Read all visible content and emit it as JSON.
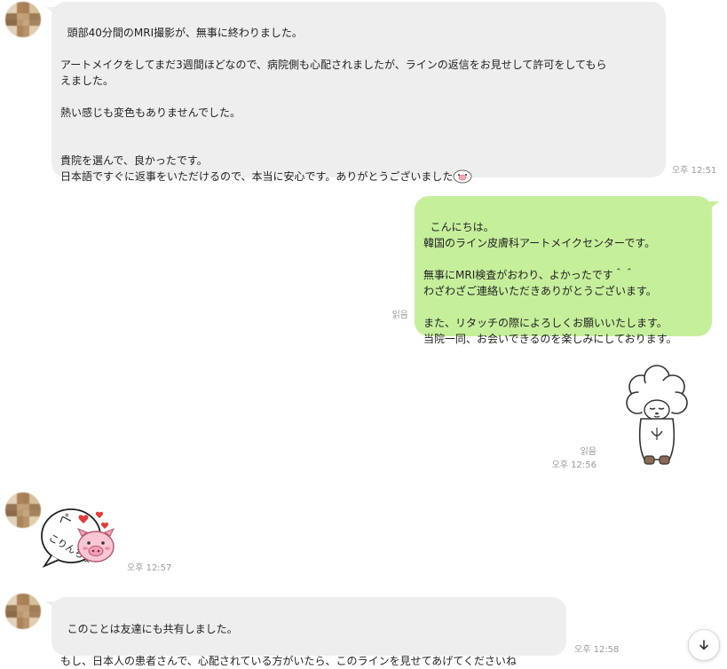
{
  "messages": [
    {
      "type": "received_text",
      "text": "頭部40分間のMRI撮影が、無事に終わりました。\n\nアートメイクをしてまだ3週間ほどなので、病院側も心配されましたが、ラインの返信をお見せして許可をしてもら\nえました。\n\n熱い感じも変色もありませんでした。\n\n\n貴院を選んで、良かったです。\n日本語ですぐに返事をいただけるので、本当に安心です。ありがとうございました",
      "time": "오후 12:51"
    },
    {
      "type": "sent_text",
      "text": "こんにちは。\n韓国のライン皮膚科アートメイクセンターです。\n\n無事にMRI検査がおわり、よかったです＾＾\nわざわざご連絡いただきありがとうございます。\n\nまた、リタッチの際によろしくお願いいたします。\n当院一同、お会いできるのを楽しみにしております。",
      "read": "읽음"
    },
    {
      "type": "sent_sticker",
      "sticker": "bowing-sheep-sticker",
      "read": "읽음",
      "time": "오후 12:56"
    },
    {
      "type": "received_sticker",
      "sticker": "pig-greeting-sticker",
      "sticker_text": "こりんちょ",
      "sticker_text_top": "ぺ",
      "time": "오후 12:57"
    },
    {
      "type": "received_text",
      "text": "このことは友達にも共有しました。\n\nもし、日本人の患者さんで、心配されている方がいたら、このラインを見せてあげてくださいね",
      "time": "오후 12:58"
    }
  ],
  "colors": {
    "received_bubble": "#eeeeee",
    "sent_bubble": "#c6ef9c",
    "meta_text": "#9a9a9a"
  },
  "icons": {
    "scroll_down": "arrow-down-icon"
  }
}
